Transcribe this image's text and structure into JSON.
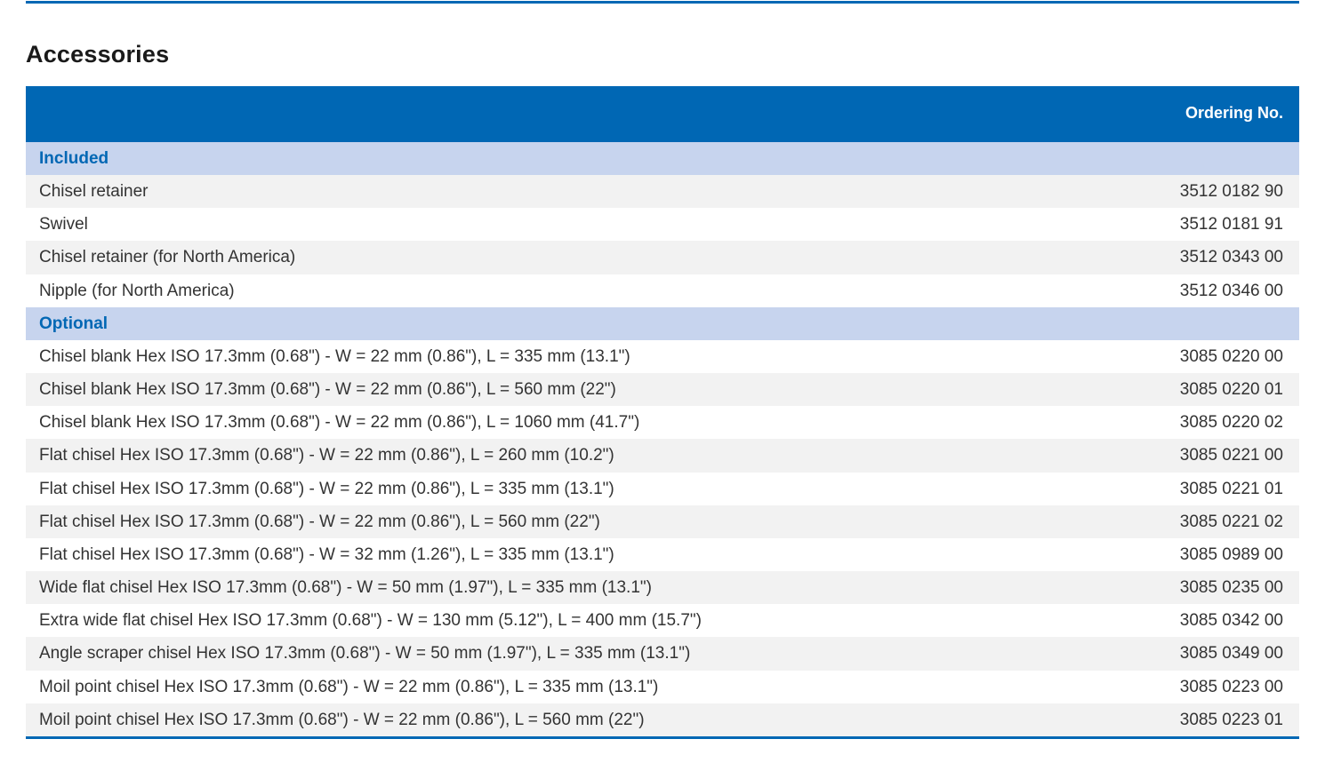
{
  "title": "Accessories",
  "table": {
    "header": {
      "description": "",
      "ordering": "Ordering No."
    },
    "groups": [
      {
        "label": "Included",
        "rows": [
          {
            "description": "Chisel retainer",
            "ordering": "3512 0182 90"
          },
          {
            "description": "Swivel",
            "ordering": "3512 0181 91"
          },
          {
            "description": "Chisel retainer (for North America)",
            "ordering": "3512 0343 00"
          },
          {
            "description": "Nipple (for North America)",
            "ordering": "3512 0346 00"
          }
        ]
      },
      {
        "label": "Optional",
        "rows": [
          {
            "description": "Chisel blank Hex ISO 17.3mm (0.68\") - W = 22 mm (0.86\"), L = 335 mm (13.1\")",
            "ordering": "3085 0220 00"
          },
          {
            "description": "Chisel blank Hex ISO 17.3mm (0.68\") - W = 22 mm (0.86\"), L = 560 mm (22\")",
            "ordering": "3085 0220 01"
          },
          {
            "description": "Chisel blank Hex ISO 17.3mm (0.68\") - W = 22 mm (0.86\"), L = 1060 mm (41.7\")",
            "ordering": "3085 0220 02"
          },
          {
            "description": "Flat chisel Hex ISO 17.3mm (0.68\") - W = 22 mm (0.86\"), L = 260 mm (10.2\")",
            "ordering": "3085 0221 00"
          },
          {
            "description": "Flat chisel Hex ISO 17.3mm (0.68\") - W = 22 mm (0.86\"), L = 335 mm (13.1\")",
            "ordering": "3085 0221 01"
          },
          {
            "description": "Flat chisel Hex ISO 17.3mm (0.68\") - W = 22 mm (0.86\"), L = 560 mm (22\")",
            "ordering": "3085 0221 02"
          },
          {
            "description": "Flat chisel Hex ISO 17.3mm (0.68\") - W = 32 mm (1.26\"), L = 335 mm (13.1\")",
            "ordering": "3085 0989 00"
          },
          {
            "description": "Wide flat chisel Hex ISO 17.3mm (0.68\") - W = 50 mm (1.97\"), L = 335 mm (13.1\")",
            "ordering": "3085 0235 00"
          },
          {
            "description": "Extra wide flat chisel Hex ISO 17.3mm (0.68\") - W = 130 mm (5.12\"), L = 400 mm (15.7\")",
            "ordering": "3085 0342 00"
          },
          {
            "description": "Angle scraper chisel Hex ISO 17.3mm (0.68\") - W = 50 mm (1.97\"), L = 335 mm (13.1\")",
            "ordering": "3085 0349 00"
          },
          {
            "description": "Moil point chisel Hex ISO 17.3mm (0.68\") - W = 22 mm (0.86\"), L = 335 mm (13.1\")",
            "ordering": "3085 0223 00"
          },
          {
            "description": "Moil point chisel Hex ISO 17.3mm (0.68\") - W = 22 mm (0.86\"), L = 560 mm (22\")",
            "ordering": "3085 0223 01"
          }
        ]
      }
    ]
  },
  "colors": {
    "accent": "#0067b4",
    "group_band": "#c7d4ee",
    "alt_row": "#f2f2f2"
  }
}
